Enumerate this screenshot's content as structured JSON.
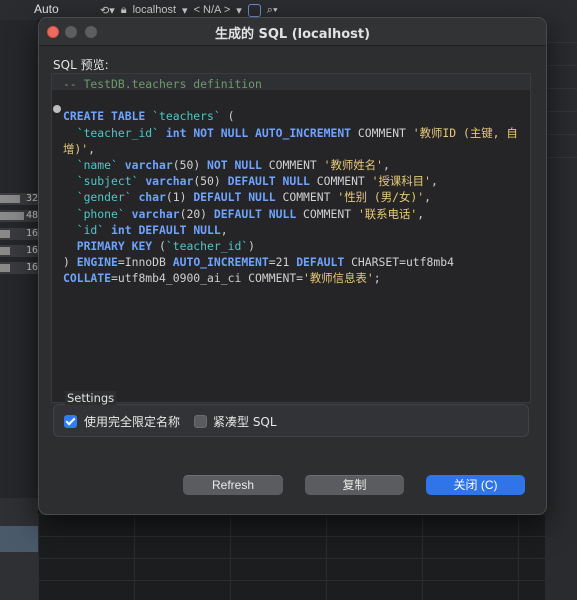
{
  "background": {
    "toolbar": {
      "auto_label": "Auto",
      "connection": "localhost",
      "database": "< N/A >"
    },
    "left_rows": [
      "32",
      "48",
      "16",
      "16",
      "16"
    ]
  },
  "dialog": {
    "title": "生成的 SQL (localhost)",
    "sql_preview_label": "SQL 预览:",
    "code_lines": [
      [
        {
          "t": "-- TestDB.teachers definition",
          "c": "comment-line"
        }
      ],
      [
        {
          "t": "",
          "c": "plain"
        }
      ],
      [
        {
          "t": "CREATE TABLE ",
          "c": "kw"
        },
        {
          "t": "`teachers`",
          "c": "bt"
        },
        {
          "t": " (",
          "c": "plain"
        }
      ],
      [
        {
          "t": "  ",
          "c": "plain"
        },
        {
          "t": "`teacher_id`",
          "c": "bt"
        },
        {
          "t": " ",
          "c": "plain"
        },
        {
          "t": "int",
          "c": "kw"
        },
        {
          "t": " ",
          "c": "plain"
        },
        {
          "t": "NOT NULL AUTO_INCREMENT",
          "c": "kw"
        },
        {
          "t": " COMMENT ",
          "c": "plain"
        },
        {
          "t": "'教师ID (主键, 自",
          "c": "str"
        }
      ],
      [
        {
          "t": "增)'",
          "c": "str"
        },
        {
          "t": ",",
          "c": "plain"
        }
      ],
      [
        {
          "t": "  ",
          "c": "plain"
        },
        {
          "t": "`name`",
          "c": "bt"
        },
        {
          "t": " ",
          "c": "plain"
        },
        {
          "t": "varchar",
          "c": "kw"
        },
        {
          "t": "(50) ",
          "c": "plain"
        },
        {
          "t": "NOT NULL",
          "c": "kw"
        },
        {
          "t": " COMMENT ",
          "c": "plain"
        },
        {
          "t": "'教师姓名'",
          "c": "str"
        },
        {
          "t": ",",
          "c": "plain"
        }
      ],
      [
        {
          "t": "  ",
          "c": "plain"
        },
        {
          "t": "`subject`",
          "c": "bt"
        },
        {
          "t": " ",
          "c": "plain"
        },
        {
          "t": "varchar",
          "c": "kw"
        },
        {
          "t": "(50) ",
          "c": "plain"
        },
        {
          "t": "DEFAULT NULL",
          "c": "kw"
        },
        {
          "t": " COMMENT ",
          "c": "plain"
        },
        {
          "t": "'授课科目'",
          "c": "str"
        },
        {
          "t": ",",
          "c": "plain"
        }
      ],
      [
        {
          "t": "  ",
          "c": "plain"
        },
        {
          "t": "`gender`",
          "c": "bt"
        },
        {
          "t": " ",
          "c": "plain"
        },
        {
          "t": "char",
          "c": "kw"
        },
        {
          "t": "(1) ",
          "c": "plain"
        },
        {
          "t": "DEFAULT NULL",
          "c": "kw"
        },
        {
          "t": " COMMENT ",
          "c": "plain"
        },
        {
          "t": "'性别 (男/女)'",
          "c": "str"
        },
        {
          "t": ",",
          "c": "plain"
        }
      ],
      [
        {
          "t": "  ",
          "c": "plain"
        },
        {
          "t": "`phone`",
          "c": "bt"
        },
        {
          "t": " ",
          "c": "plain"
        },
        {
          "t": "varchar",
          "c": "kw"
        },
        {
          "t": "(20) ",
          "c": "plain"
        },
        {
          "t": "DEFAULT NULL",
          "c": "kw"
        },
        {
          "t": " COMMENT ",
          "c": "plain"
        },
        {
          "t": "'联系电话'",
          "c": "str"
        },
        {
          "t": ",",
          "c": "plain"
        }
      ],
      [
        {
          "t": "  ",
          "c": "plain"
        },
        {
          "t": "`id`",
          "c": "bt"
        },
        {
          "t": " ",
          "c": "plain"
        },
        {
          "t": "int",
          "c": "kw"
        },
        {
          "t": " ",
          "c": "plain"
        },
        {
          "t": "DEFAULT NULL",
          "c": "kw"
        },
        {
          "t": ",",
          "c": "plain"
        }
      ],
      [
        {
          "t": "  ",
          "c": "plain"
        },
        {
          "t": "PRIMARY KEY",
          "c": "kw"
        },
        {
          "t": " (",
          "c": "plain"
        },
        {
          "t": "`teacher_id`",
          "c": "bt"
        },
        {
          "t": ")",
          "c": "plain"
        }
      ],
      [
        {
          "t": ") ",
          "c": "plain"
        },
        {
          "t": "ENGINE",
          "c": "kw"
        },
        {
          "t": "=InnoDB ",
          "c": "plain"
        },
        {
          "t": "AUTO_INCREMENT",
          "c": "kw"
        },
        {
          "t": "=21 ",
          "c": "plain"
        },
        {
          "t": "DEFAULT",
          "c": "kw"
        },
        {
          "t": " CHARSET=utf8mb4",
          "c": "plain"
        }
      ],
      [
        {
          "t": "COLLATE",
          "c": "kw"
        },
        {
          "t": "=utf8mb4_0900_ai_ci COMMENT=",
          "c": "plain"
        },
        {
          "t": "'教师信息表'",
          "c": "str"
        },
        {
          "t": ";",
          "c": "plain"
        }
      ]
    ],
    "settings": {
      "title": "Settings",
      "fully_qualified_label": "使用完全限定名称",
      "fully_qualified_checked": true,
      "compact_label": "紧凑型 SQL",
      "compact_checked": false
    },
    "buttons": {
      "refresh": "Refresh",
      "copy": "复制",
      "close": "关闭 (C)"
    }
  }
}
